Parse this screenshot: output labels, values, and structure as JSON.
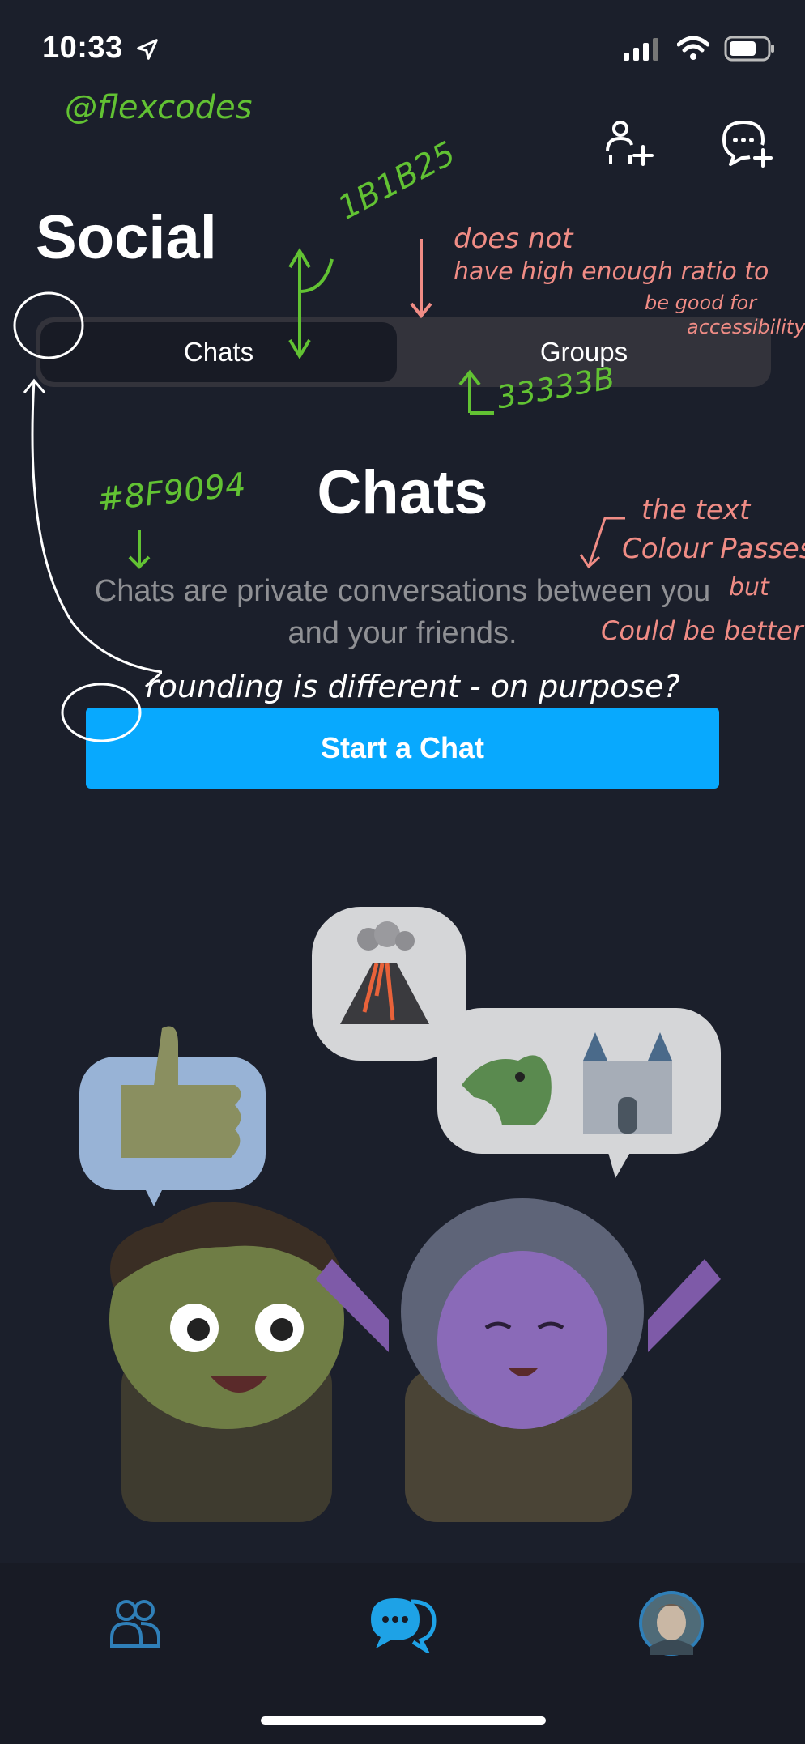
{
  "status_bar": {
    "time": "10:33"
  },
  "header": {
    "title": "Social"
  },
  "segmented": {
    "chats_label": "Chats",
    "groups_label": "Groups"
  },
  "content": {
    "heading": "Chats",
    "description": "Chats are private conversations between you and your friends.",
    "cta_label": "Start a Chat"
  },
  "annotations": {
    "signature": "@flexcodes",
    "active_hex": "1B1B25",
    "inactive_hex": "33333B",
    "text_hex": "#8F9094",
    "contrast_note_1": "does not",
    "contrast_note_2": "have high enough ratio to",
    "contrast_note_3": "be good for",
    "contrast_note_4": "accessibility",
    "text_note_1": "the text",
    "text_note_2": "Colour Passes",
    "text_note_3": "but",
    "text_note_4": "Could be better",
    "rounding_note": "rounding is different - on purpose?"
  },
  "colors": {
    "background": "#1B1F2B",
    "segment_active": "#181B25",
    "segment_track": "#33333B",
    "muted_text": "#8F9094",
    "accent": "#08A9FE"
  },
  "icons": {
    "add_friend": "add-friend-icon",
    "new_chat": "new-chat-icon",
    "friends_tab": "friends-icon",
    "chats_tab": "chats-icon",
    "profile_tab": "avatar"
  }
}
